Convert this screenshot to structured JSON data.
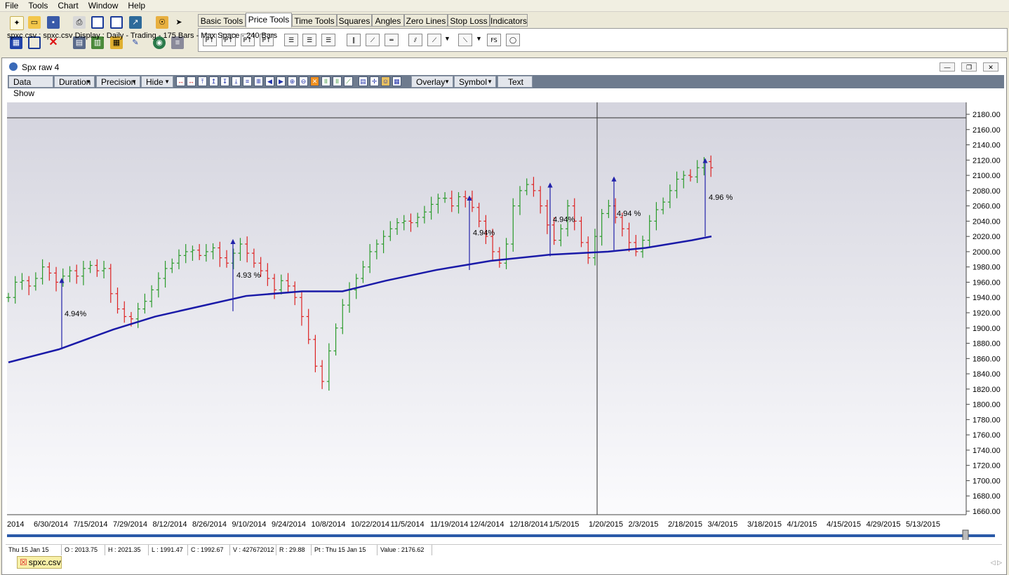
{
  "menu": [
    "File",
    "Tools",
    "Chart",
    "Window",
    "Help"
  ],
  "toolbar_icons": [
    "new-icon",
    "open-icon",
    "save-icon",
    "print-icon",
    "layout-h-icon",
    "layout-v-icon",
    "export-icon",
    "lock-icon",
    "pointer-icon",
    "grid-icon",
    "square-icon",
    "close-red-icon",
    "film-icon",
    "tile-icon",
    "calc-icon",
    "pen-icon",
    "globe-icon",
    "stack-icon"
  ],
  "tool_tabs": [
    "Basic Tools",
    "Price Tools",
    "Time Tools",
    "Squares",
    "Angles",
    "Zero Lines",
    "Stop Loss",
    "Indicators"
  ],
  "active_tab": "Price Tools",
  "price_tool_icons": [
    "P1",
    "P2",
    "P3",
    "P4",
    "list1",
    "list2",
    "list3",
    "diag1",
    "diag2",
    "diag3",
    "fan1",
    "fan2",
    "fan3",
    "fs",
    "ellipse"
  ],
  "window": {
    "title": "Spx raw  4"
  },
  "chart_toolbar": {
    "data_show": "Data Show",
    "duration": "Duration",
    "precision": "Precision",
    "hide": "Hide",
    "overlay": "Overlay",
    "symbol": "Symbol",
    "text": "Text"
  },
  "info_line": "spxc.csv : spxc.csv Display :  Daily  - Trading - 175 Bars -  Max Space - 240 Bars",
  "chart_data": {
    "type": "bar",
    "title": "",
    "y_ticks": [
      "2180.00",
      "2160.00",
      "2140.00",
      "2120.00",
      "2100.00",
      "2080.00",
      "2060.00",
      "2040.00",
      "2020.00",
      "2000.00",
      "1980.00",
      "1960.00",
      "1940.00",
      "1920.00",
      "1900.00",
      "1880.00",
      "1860.00",
      "1840.00",
      "1820.00",
      "1800.00",
      "1780.00",
      "1760.00",
      "1740.00",
      "1720.00",
      "1700.00",
      "1680.00",
      "1660.00"
    ],
    "ylim": [
      1650,
      2190
    ],
    "x_ticks": [
      "2014",
      "6/30/2014",
      "7/15/2014",
      "7/29/2014",
      "8/12/2014",
      "8/26/2014",
      "9/10/2014",
      "9/24/2014",
      "10/8/2014",
      "10/22/2014",
      "11/5/2014",
      "11/19/2014",
      "12/4/2014",
      "12/18/2014",
      "1/5/2015",
      "1/20/2015",
      "2/3/2015",
      "2/18/2015",
      "3/4/2015",
      "3/18/2015",
      "4/1/2015",
      "4/15/2015",
      "4/29/2015",
      "5/13/2015"
    ],
    "price_close_path": [
      [
        0,
        1940
      ],
      [
        6,
        1960
      ],
      [
        12,
        1962
      ],
      [
        18,
        1955
      ],
      [
        24,
        1965
      ],
      [
        30,
        1980
      ],
      [
        36,
        1972
      ],
      [
        42,
        1960
      ],
      [
        48,
        1968
      ],
      [
        54,
        1975
      ],
      [
        60,
        1968
      ],
      [
        66,
        1978
      ],
      [
        72,
        1982
      ],
      [
        78,
        1975
      ],
      [
        84,
        1978
      ],
      [
        90,
        1945
      ],
      [
        96,
        1925
      ],
      [
        102,
        1915
      ],
      [
        108,
        1912
      ],
      [
        114,
        1925
      ],
      [
        120,
        1935
      ],
      [
        126,
        1950
      ],
      [
        132,
        1965
      ],
      [
        138,
        1978
      ],
      [
        144,
        1985
      ],
      [
        150,
        1995
      ],
      [
        156,
        2000
      ],
      [
        162,
        2002
      ],
      [
        168,
        1995
      ],
      [
        174,
        2000
      ],
      [
        180,
        2005
      ],
      [
        186,
        1992
      ],
      [
        192,
        1985
      ],
      [
        198,
        1998
      ],
      [
        204,
        2010
      ],
      [
        210,
        1998
      ],
      [
        216,
        1985
      ],
      [
        222,
        1975
      ],
      [
        228,
        1965
      ],
      [
        234,
        1950
      ],
      [
        240,
        1962
      ],
      [
        246,
        1955
      ],
      [
        252,
        1940
      ],
      [
        258,
        1915
      ],
      [
        264,
        1885
      ],
      [
        270,
        1850
      ],
      [
        276,
        1830
      ],
      [
        282,
        1870
      ],
      [
        288,
        1900
      ],
      [
        294,
        1930
      ],
      [
        300,
        1950
      ],
      [
        306,
        1965
      ],
      [
        312,
        1980
      ],
      [
        318,
        2000
      ],
      [
        324,
        2010
      ],
      [
        330,
        2020
      ],
      [
        336,
        2030
      ],
      [
        342,
        2038
      ],
      [
        348,
        2040
      ],
      [
        354,
        2038
      ],
      [
        360,
        2045
      ],
      [
        366,
        2052
      ],
      [
        372,
        2062
      ],
      [
        378,
        2070
      ],
      [
        384,
        2070
      ],
      [
        390,
        2060
      ],
      [
        396,
        2072
      ],
      [
        402,
        2070
      ],
      [
        408,
        2058
      ],
      [
        414,
        2040
      ],
      [
        420,
        2020
      ],
      [
        426,
        2000
      ],
      [
        432,
        1985
      ],
      [
        438,
        2010
      ],
      [
        444,
        2060
      ],
      [
        450,
        2080
      ],
      [
        456,
        2088
      ],
      [
        462,
        2080
      ],
      [
        468,
        2060
      ],
      [
        474,
        2035
      ],
      [
        480,
        2015
      ],
      [
        486,
        2030
      ],
      [
        492,
        2060
      ],
      [
        498,
        2040
      ],
      [
        504,
        2012
      ],
      [
        510,
        1992
      ],
      [
        516,
        2020
      ],
      [
        522,
        2050
      ],
      [
        528,
        2060
      ],
      [
        534,
        2045
      ],
      [
        540,
        2030
      ],
      [
        546,
        2012
      ],
      [
        552,
        2000
      ],
      [
        558,
        2015
      ],
      [
        564,
        2040
      ],
      [
        570,
        2055
      ],
      [
        576,
        2065
      ],
      [
        582,
        2080
      ],
      [
        588,
        2095
      ],
      [
        594,
        2100
      ],
      [
        600,
        2098
      ],
      [
        606,
        2110
      ],
      [
        612,
        2118
      ],
      [
        618,
        2110
      ]
    ],
    "moving_average_path": [
      [
        0,
        1855
      ],
      [
        72,
        1872
      ],
      [
        150,
        1898
      ],
      [
        210,
        1915
      ],
      [
        282,
        1930
      ],
      [
        340,
        1942
      ],
      [
        420,
        1948
      ],
      [
        478,
        1948
      ],
      [
        540,
        1962
      ],
      [
        612,
        1976
      ],
      [
        690,
        1988
      ],
      [
        774,
        1996
      ],
      [
        858,
        2000
      ],
      [
        912,
        2005
      ],
      [
        978,
        2015
      ],
      [
        1006,
        2020
      ]
    ],
    "annotations": [
      {
        "label": "4.94%",
        "from": [
          1872
        ],
        "to": [
          1966
        ]
      },
      {
        "label": "4.93 %",
        "from": [
          1922
        ],
        "to": [
          2017
        ]
      },
      {
        "label": "4.94%",
        "from": [
          1976
        ],
        "to": [
          2074
        ]
      },
      {
        "label": "4.94%",
        "from": [
          1994
        ],
        "to": [
          2091
        ]
      },
      {
        "label": "4.94 %",
        "from": [
          2002
        ],
        "to": [
          2099
        ]
      },
      {
        "label": "4.96 %",
        "from": [
          2020
        ],
        "to": [
          2123
        ]
      }
    ]
  },
  "status": {
    "date": "Thu 15 Jan 15",
    "open": "O : 2013.75",
    "high": "H : 2021.35",
    "low": "L : 1991.47",
    "close": "C : 1992.67",
    "volume": "V : 427672012",
    "range": "R : 29.88",
    "pt": "Pt : Thu 15 Jan 15",
    "value": "Value : 2176.62"
  },
  "bottom_tab": "spxc.csv",
  "colors": {
    "up": "#2a9a2a",
    "down": "#dd2222",
    "ma": "#1a1aa8",
    "arrow": "#2222aa",
    "toolbar": "#6e7b8e"
  }
}
